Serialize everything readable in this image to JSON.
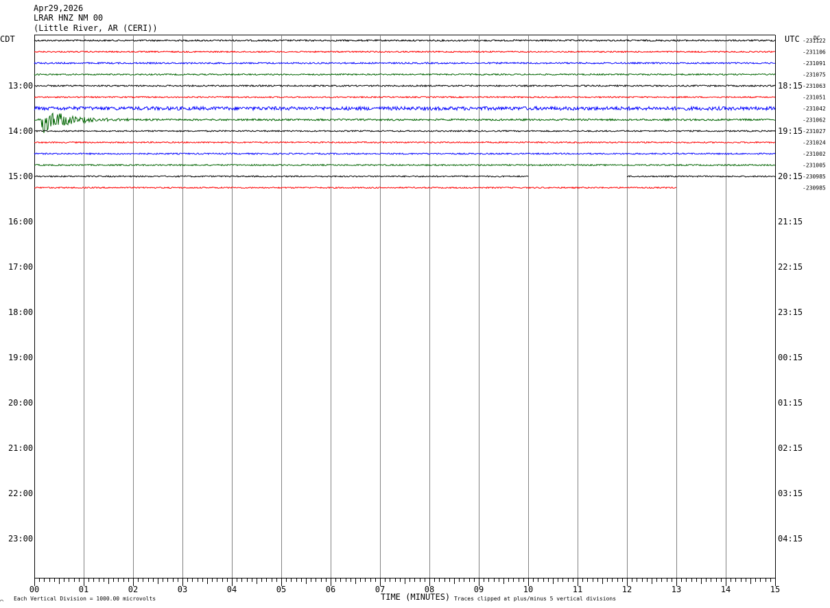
{
  "header": {
    "date": "Apr29,2026",
    "station": "LRAR HNZ NM 00",
    "location": "(Little River, AR (CERI))"
  },
  "left_zone_label": "CDT",
  "right_zone_label": "UTC",
  "dc_label": "DC",
  "footer": {
    "mark": "⌒",
    "scale_note": "Each Vertical Division = 1000.00 microvolts",
    "axis_title": "TIME (MINUTES)",
    "clip_note": "Traces clipped at plus/minus 5 vertical divisions"
  },
  "colors": {
    "black": "#000000",
    "red": "#ff0000",
    "blue": "#0000ff",
    "green": "#006400",
    "grid": "#808080"
  },
  "chart_data": {
    "type": "line",
    "xlabel": "TIME (MINUTES)",
    "x_ticks": [
      "00",
      "01",
      "02",
      "03",
      "04",
      "05",
      "06",
      "07",
      "08",
      "09",
      "10",
      "11",
      "12",
      "13",
      "14",
      "15"
    ],
    "xlim": [
      0,
      15
    ],
    "minutes_per_line": 15,
    "left_hour_labels": [
      "13:00",
      "14:00",
      "15:00",
      "16:00",
      "17:00",
      "18:00",
      "19:00",
      "20:00",
      "21:00",
      "22:00",
      "23:00"
    ],
    "right_hour_labels": [
      "18:15",
      "19:15",
      "20:15",
      "21:15",
      "22:15",
      "23:15",
      "00:15",
      "01:15",
      "02:15",
      "03:15",
      "04:15"
    ],
    "series": [
      {
        "color": "black",
        "dc": "-231122",
        "start_min": 0,
        "end_min": 15,
        "amp": 1.2
      },
      {
        "color": "red",
        "dc": "-231106",
        "start_min": 0,
        "end_min": 15,
        "amp": 1.0
      },
      {
        "color": "blue",
        "dc": "-231091",
        "start_min": 0,
        "end_min": 15,
        "amp": 1.1
      },
      {
        "color": "green",
        "dc": "-231075",
        "start_min": 0,
        "end_min": 15,
        "amp": 1.0
      },
      {
        "color": "black",
        "dc": "-231063",
        "start_min": 0,
        "end_min": 15,
        "amp": 1.1
      },
      {
        "color": "red",
        "dc": "-231051",
        "start_min": 0,
        "end_min": 15,
        "amp": 1.0
      },
      {
        "color": "blue",
        "dc": "-231042",
        "start_min": 0,
        "end_min": 15,
        "amp": 2.6
      },
      {
        "color": "green",
        "dc": "-231062",
        "start_min": 0,
        "end_min": 15,
        "amp": 1.3,
        "event": {
          "at_min": 0.15,
          "peak": 40,
          "decay_min": 0.5
        }
      },
      {
        "color": "black",
        "dc": "-231027",
        "start_min": 0,
        "end_min": 15,
        "amp": 1.0
      },
      {
        "color": "red",
        "dc": "-231024",
        "start_min": 0,
        "end_min": 15,
        "amp": 1.0
      },
      {
        "color": "blue",
        "dc": "-231002",
        "start_min": 0,
        "end_min": 15,
        "amp": 1.0
      },
      {
        "color": "green",
        "dc": "-231005",
        "start_min": 0,
        "end_min": 15,
        "amp": 1.0
      },
      {
        "color": "black",
        "dc": "-230985",
        "start_min": 0,
        "end_min": 15,
        "amp": 1.0,
        "gap_min": [
          10,
          12
        ]
      },
      {
        "color": "red",
        "dc": "-230985",
        "start_min": 0,
        "end_min": 13,
        "amp": 1.0
      }
    ]
  }
}
